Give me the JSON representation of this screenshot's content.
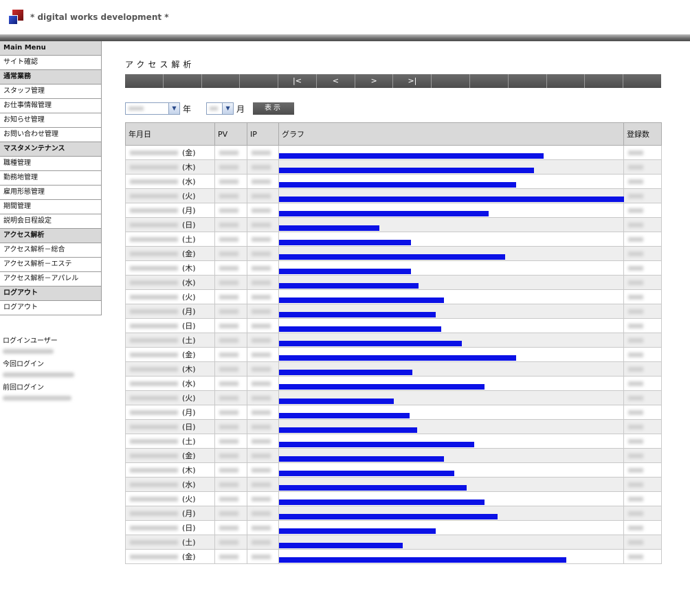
{
  "header": {
    "brand": "* digital works development *"
  },
  "sidebar": {
    "sections": [
      {
        "title": "Main Menu",
        "items": [
          "サイト確認"
        ]
      },
      {
        "title": "通常業務",
        "items": [
          "スタッフ管理",
          "お仕事情報管理",
          "お知らせ管理",
          "お問い合わせ管理"
        ]
      },
      {
        "title": "マスタメンテナンス",
        "items": [
          "職種管理",
          "勤務地管理",
          "雇用形態管理",
          "期間管理",
          "説明会日程設定"
        ]
      },
      {
        "title": "アクセス解析",
        "items": [
          "アクセス解析－総合",
          "アクセス解析－エステ",
          "アクセス解析－アパレル"
        ]
      },
      {
        "title": "ログアウト",
        "items": [
          "ログアウト"
        ]
      }
    ],
    "login": {
      "user_label": "ログインユーザー",
      "current_label": "今回ログイン",
      "previous_label": "前回ログイン"
    }
  },
  "main": {
    "title": "アクセス解析",
    "pager": [
      "",
      "",
      "",
      "",
      "|<",
      "<",
      ">",
      ">|",
      "",
      "",
      "",
      "",
      "",
      ""
    ],
    "filter": {
      "year_unit": "年",
      "month_unit": "月",
      "show_button": "表示"
    },
    "table": {
      "headers": [
        "年月日",
        "PV",
        "IP",
        "グラフ",
        "登録数"
      ],
      "rows": [
        {
          "dow": "(金)",
          "bar": 0.766
        },
        {
          "dow": "(木)",
          "bar": 0.74
        },
        {
          "dow": "(水)",
          "bar": 0.688
        },
        {
          "dow": "(火)",
          "bar": 1.0
        },
        {
          "dow": "(月)",
          "bar": 0.608
        },
        {
          "dow": "(日)",
          "bar": 0.29
        },
        {
          "dow": "(土)",
          "bar": 0.382
        },
        {
          "dow": "(金)",
          "bar": 0.656
        },
        {
          "dow": "(木)",
          "bar": 0.382
        },
        {
          "dow": "(水)",
          "bar": 0.404
        },
        {
          "dow": "(火)",
          "bar": 0.479
        },
        {
          "dow": "(月)",
          "bar": 0.454
        },
        {
          "dow": "(日)",
          "bar": 0.47
        },
        {
          "dow": "(土)",
          "bar": 0.53
        },
        {
          "dow": "(金)",
          "bar": 0.688
        },
        {
          "dow": "(木)",
          "bar": 0.386
        },
        {
          "dow": "(水)",
          "bar": 0.596
        },
        {
          "dow": "(火)",
          "bar": 0.333
        },
        {
          "dow": "(月)",
          "bar": 0.378
        },
        {
          "dow": "(日)",
          "bar": 0.4
        },
        {
          "dow": "(土)",
          "bar": 0.566
        },
        {
          "dow": "(金)",
          "bar": 0.479
        },
        {
          "dow": "(木)",
          "bar": 0.508
        },
        {
          "dow": "(水)",
          "bar": 0.544
        },
        {
          "dow": "(火)",
          "bar": 0.596
        },
        {
          "dow": "(月)",
          "bar": 0.634
        },
        {
          "dow": "(日)",
          "bar": 0.454
        },
        {
          "dow": "(土)",
          "bar": 0.359
        },
        {
          "dow": "(金)",
          "bar": 0.832
        }
      ]
    }
  },
  "colors": {
    "bar": "#0b11e6",
    "header_bg": "#d9d9d9",
    "button_bg": "#5a5a5a"
  }
}
